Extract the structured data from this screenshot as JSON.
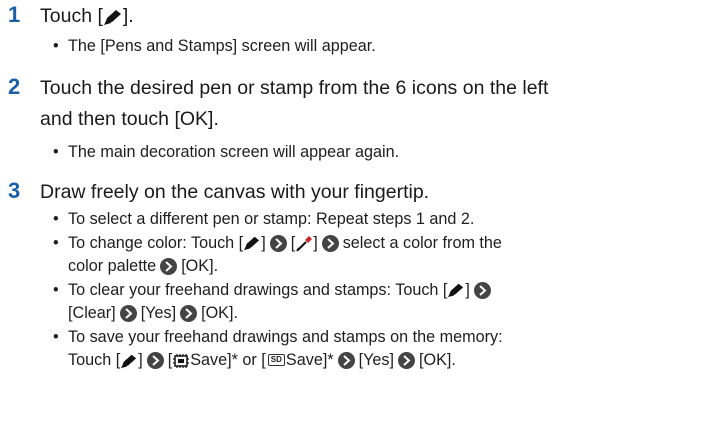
{
  "steps": [
    {
      "number": "1",
      "main": [
        "Touch [",
        "pen-icon",
        "]."
      ],
      "bullets": [
        "The [Pens and Stamps] screen will appear."
      ]
    },
    {
      "number": "2",
      "main_line1": "Touch the desired pen or stamp from the 6 icons on the left",
      "main_line2": "and then touch [OK].",
      "bullets": [
        "The main decoration screen will appear again."
      ]
    },
    {
      "number": "3",
      "main": "Draw freely on the canvas with your fingertip.",
      "b1": "To select a different pen or stamp: Repeat steps 1 and 2.",
      "b2": {
        "t1": "To change color: Touch [",
        "t2": "]",
        "t3": "[",
        "t4": "]",
        "t5": "select a color from the",
        "t6": "color palette",
        "t7": "[OK]."
      },
      "b3": {
        "t1": "To clear your freehand drawings and stamps: Touch [",
        "t2": "]",
        "t3": "[Clear]",
        "t4": "[Yes]",
        "t5": "[OK]."
      },
      "b4": {
        "t1": "To save your freehand drawings and stamps on the memory:",
        "t2": "Touch [",
        "t3": "]",
        "t4": "[",
        "t5": "Save]* or [",
        "sd": "SD",
        "t6": "Save]*",
        "t7": "[Yes]",
        "t8": "[OK]."
      }
    }
  ],
  "icons": {
    "pen": "pen-icon",
    "dropper": "eyedropper-icon",
    "memory": "built-in-memory-icon",
    "sd": "sd-card-icon",
    "arrow": "right-arrow-icon"
  },
  "colors": {
    "step_number": "#1b5fa8",
    "text": "#1a1a1a"
  }
}
